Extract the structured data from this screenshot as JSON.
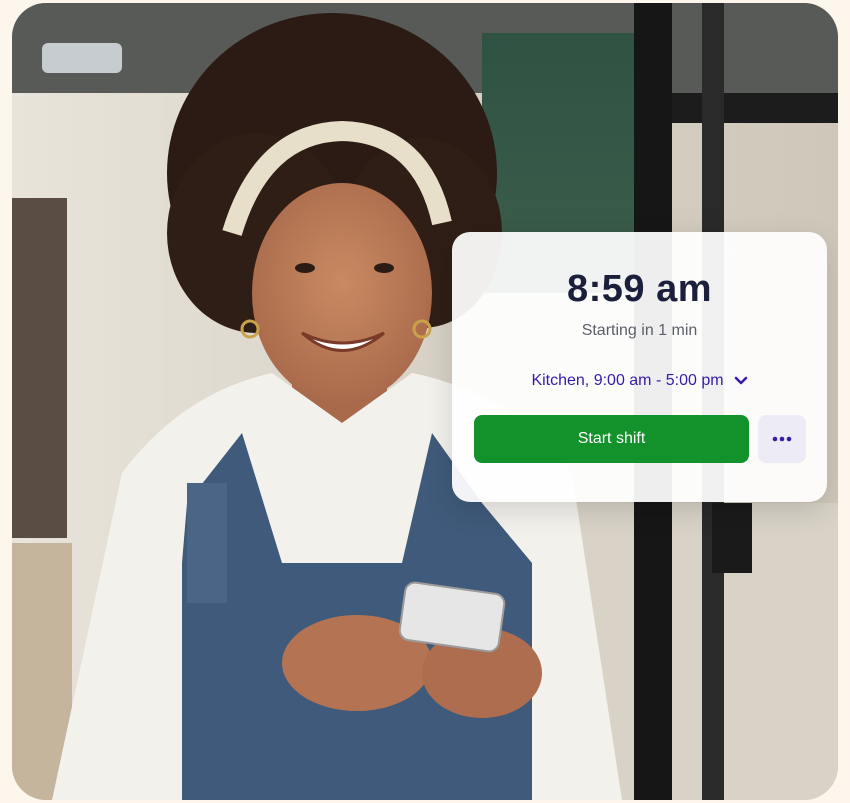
{
  "clock": {
    "time": "8:59 am",
    "status": "Starting in 1 min"
  },
  "shift": {
    "selection": "Kitchen, 9:00 am - 5:00 pm",
    "dropdown_icon": "chevron-down-icon"
  },
  "actions": {
    "start_label": "Start shift",
    "more_icon": "more-horizontal-icon"
  },
  "colors": {
    "primary_green": "#13922b",
    "accent_purple": "#3a1aa8",
    "time_text": "#1b1f3b"
  }
}
